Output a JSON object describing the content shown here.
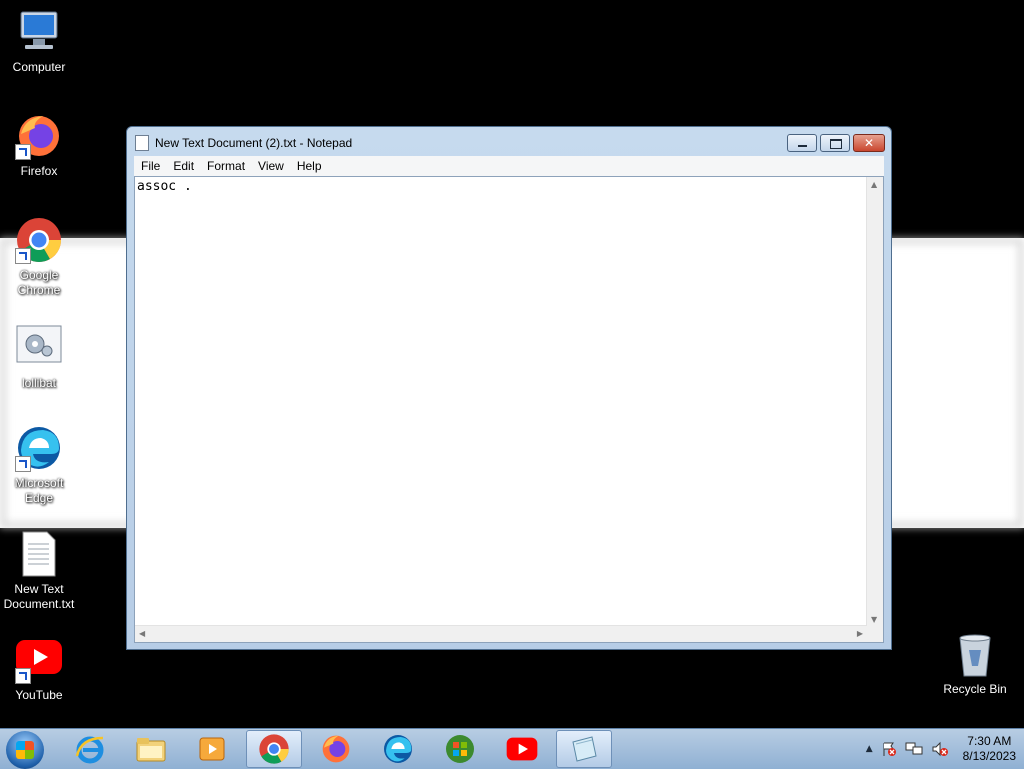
{
  "desktop": {
    "icons": [
      {
        "label": "Computer",
        "icon": "computer-icon"
      },
      {
        "label": "Firefox",
        "icon": "firefox-icon"
      },
      {
        "label": "Google Chrome",
        "icon": "chrome-icon"
      },
      {
        "label": "lollibat",
        "icon": "settings-file-icon"
      },
      {
        "label": "Microsoft Edge",
        "icon": "edge-icon"
      },
      {
        "label": "New Text Document.txt",
        "icon": "text-file-icon"
      },
      {
        "label": "YouTube",
        "icon": "youtube-icon"
      },
      {
        "label": "Recycle Bin",
        "icon": "recycle-bin-icon"
      }
    ]
  },
  "notepad": {
    "title": "New Text Document (2).txt - Notepad",
    "menu": [
      "File",
      "Edit",
      "Format",
      "View",
      "Help"
    ],
    "content": "assoc ."
  },
  "taskbar": {
    "items": [
      "start-icon",
      "ie-icon",
      "explorer-icon",
      "media-player-icon",
      "chrome-icon",
      "firefox-icon",
      "edge-icon",
      "windows-media-center-icon",
      "youtube-icon",
      "notepad-icon"
    ],
    "active": "notepad-icon",
    "tray_icons": [
      "show-hidden-icons",
      "action-center-icon",
      "network-icon",
      "volume-muted-icon"
    ],
    "time": "7:30 AM",
    "date": "8/13/2023"
  }
}
